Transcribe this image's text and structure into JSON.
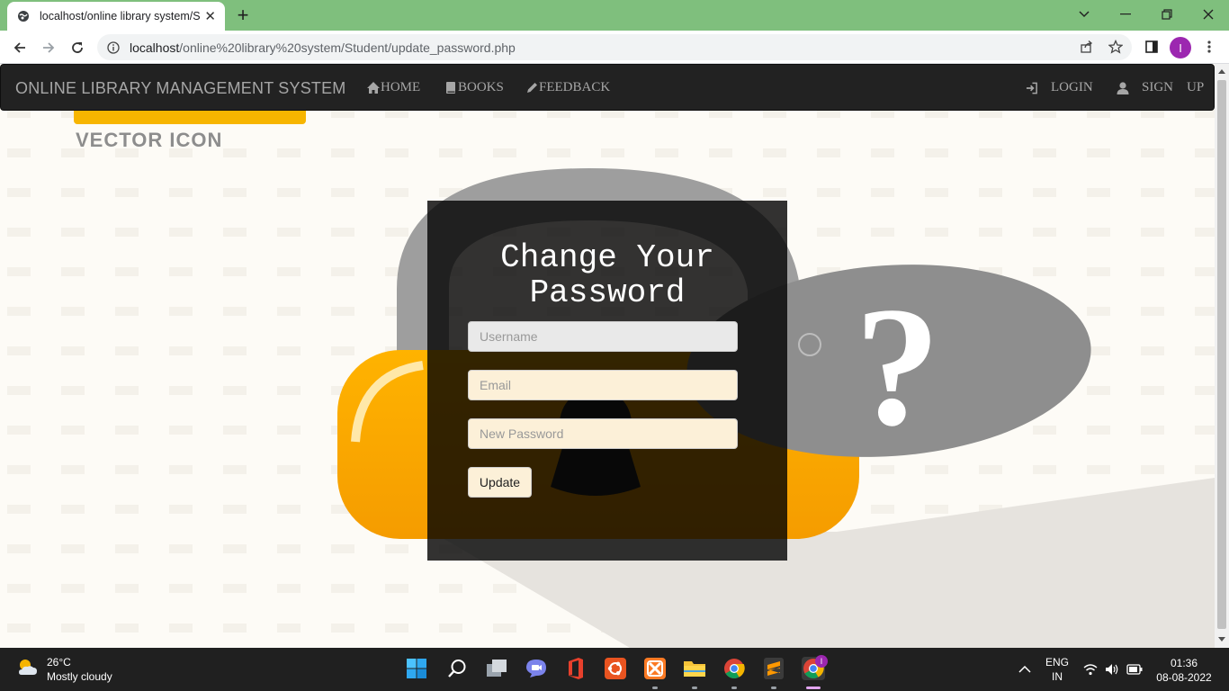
{
  "browser": {
    "tab_title": "localhost/online library system/St",
    "url_host": "localhost",
    "url_path": "/online%20library%20system/Student/update_password.php",
    "profile_initial": "I"
  },
  "site": {
    "brand": "ONLINE LIBRARY MANAGEMENT SYSTEM",
    "nav": {
      "home": "HOME",
      "books": "BOOKS",
      "feedback": "FEEDBACK",
      "login": "LOGIN",
      "signup": "SIGN    UP"
    }
  },
  "background": {
    "caption": "VECTOR ICON",
    "question_mark": "?"
  },
  "form": {
    "heading": "Change Your Password",
    "username_placeholder": "Username",
    "email_placeholder": "Email",
    "password_placeholder": "New Password",
    "submit_label": "Update"
  },
  "taskbar": {
    "temperature": "26°C",
    "weather": "Mostly cloudy",
    "lang": "ENG",
    "region": "IN",
    "time": "01:36",
    "date": "08-08-2022",
    "chrome_badge": "I"
  },
  "colors": {
    "tabstrip": "#7fbf7d",
    "navbar": "#222222",
    "panel": "rgba(0,0,0,0.8)",
    "input_tint": "#fcf0d8"
  }
}
